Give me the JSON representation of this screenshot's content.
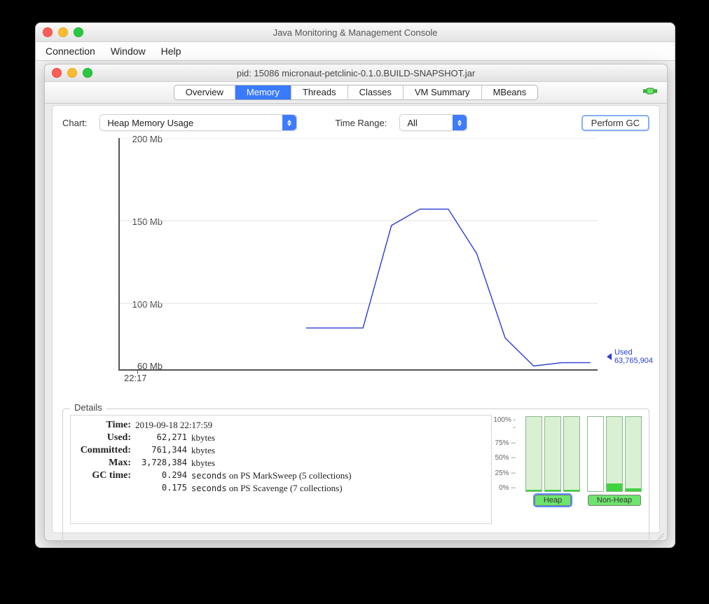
{
  "outer_window": {
    "title": "Java Monitoring & Management Console",
    "menu": {
      "connection": "Connection",
      "window": "Window",
      "help": "Help"
    }
  },
  "inner_window": {
    "title": "pid: 15086 micronaut-petclinic-0.1.0.BUILD-SNAPSHOT.jar"
  },
  "tabs": {
    "overview": "Overview",
    "memory": "Memory",
    "threads": "Threads",
    "classes": "Classes",
    "vm_summary": "VM Summary",
    "mbeans": "MBeans",
    "active": "memory"
  },
  "controls": {
    "chart_label": "Chart:",
    "chart_value": "Heap Memory Usage",
    "time_range_label": "Time Range:",
    "time_range_value": "All",
    "perform_gc": "Perform GC"
  },
  "chart_data": {
    "type": "line",
    "title": "",
    "xlabel": "",
    "ylabel": "",
    "y_unit": "Mb",
    "ylim": [
      60,
      200
    ],
    "y_ticks": [
      60,
      100,
      150,
      200
    ],
    "y_tick_labels": [
      "60 Mb",
      "100 Mb",
      "150 Mb",
      "200 Mb"
    ],
    "x_tick_labels": [
      "22:17"
    ],
    "series": [
      {
        "name": "Used",
        "values_mb": [
          85,
          85,
          85,
          147,
          157,
          157,
          130,
          79,
          62,
          64,
          64
        ],
        "current_bytes_label": "63,765,904"
      }
    ]
  },
  "details": {
    "title": "Details",
    "rows": {
      "time": {
        "k": "Time:",
        "v": "2019-09-18 22:17:59",
        "u": ""
      },
      "used": {
        "k": "Used:",
        "v": "62,271",
        "u": "kbytes"
      },
      "committed": {
        "k": "Committed:",
        "v": "761,344",
        "u": "kbytes"
      },
      "max": {
        "k": "Max:",
        "v": "3,728,384",
        "u": "kbytes"
      },
      "gc": {
        "k": "GC time:",
        "v1": "0.294",
        "t1": " seconds on PS MarkSweep (5 collections)",
        "v2": "0.175",
        "t2": " seconds on PS Scavenge (7 collections)"
      }
    },
    "pct_labels": {
      "p100": "100% --",
      "p75": "75% --",
      "p50": "50% --",
      "p25": "25% --",
      "p0": "0% --"
    },
    "heap": {
      "label": "Heap",
      "bars_fill_pct": [
        2,
        2,
        2
      ]
    },
    "non_heap": {
      "label": "Non-Heap",
      "bars_fill_pct": [
        0,
        10,
        4
      ]
    }
  }
}
